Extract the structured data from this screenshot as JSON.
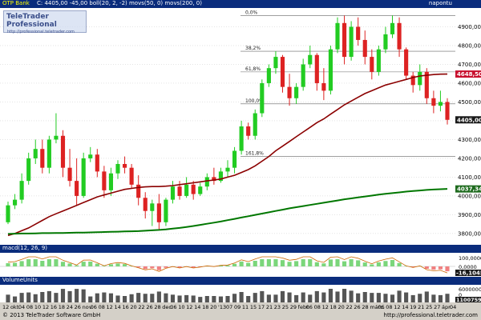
{
  "header": {
    "symbol": "OTP Bank",
    "indicators": "C: 4405,00 -45,00 boll(20, 2, -2) movs(50, 0) movs(200, 0)",
    "period_label": "napontu"
  },
  "watermark": {
    "brand": "TeleTrader Professional",
    "url": "http://professional.teletrader.com"
  },
  "macd": {
    "label": "macd(12, 26, 9)",
    "ticks": [
      "100,0000",
      "0,0000"
    ],
    "current": "-16,1045"
  },
  "volume": {
    "label": "VolumeUnits",
    "ticks": [
      "6000000",
      "0"
    ],
    "current": "1100759"
  },
  "footer": {
    "copyright": "© 2013 TeleTrader Software GmbH",
    "url": "http://professional.teletrader.com"
  },
  "colors": {
    "bull": "#22cc22",
    "bear": "#dd2222",
    "ma50": "#8b0000",
    "ma200": "#007700",
    "strip": "#0a2c7c"
  },
  "chart_data": {
    "type": "candlestick",
    "title": "OTP Bank",
    "ylim": [
      3740,
      5000
    ],
    "y_ticks": [
      3800,
      3900,
      4000,
      4100,
      4200,
      4300,
      4400,
      4500,
      4600,
      4700,
      4800,
      4900
    ],
    "y_tick_labels": [
      "3800,00",
      "3900,00",
      "4000,00",
      "4100,00",
      "4200,00",
      "4300,00",
      "4400,00",
      "4500,00",
      "4600,00",
      "4700,00",
      "4800,00",
      "4900,00"
    ],
    "x_labels": [
      "12",
      "okt.",
      "04",
      "08",
      "10",
      "12",
      "16",
      "18",
      "24",
      "26",
      "nov.",
      "06",
      "08",
      "12",
      "14",
      "16",
      "20",
      "22",
      "26",
      "28",
      "dec.",
      "06",
      "10",
      "12",
      "14",
      "18",
      "20",
      "'13",
      "07",
      "09",
      "11",
      "15",
      "17",
      "21",
      "23",
      "25",
      "29",
      "febr.",
      "06",
      "08",
      "12",
      "18",
      "20",
      "22",
      "26",
      "28",
      "márc.",
      "06",
      "08",
      "12",
      "14",
      "19",
      "21",
      "25",
      "27",
      "ápr.",
      "04"
    ],
    "price_tags": [
      {
        "label": "4648,50",
        "value": 4648.5,
        "color": "#c8102e"
      },
      {
        "label": "4405,00",
        "value": 4405,
        "color": "#1a1a1a"
      },
      {
        "label": "4037,34",
        "value": 4037.34,
        "color": "#1e6b1e"
      }
    ],
    "fib_levels": [
      {
        "label": "0,0%",
        "value": 4960
      },
      {
        "label": "38,2%",
        "value": 4770
      },
      {
        "label": "61,8%",
        "value": 4660
      },
      {
        "label": "100,0%",
        "value": 4490
      },
      {
        "label": "161,8%",
        "value": 4210
      }
    ],
    "series": [
      {
        "name": "ohlc",
        "values": [
          [
            3860,
            3970,
            3850,
            3950
          ],
          [
            3950,
            4010,
            3930,
            3980
          ],
          [
            3980,
            4120,
            3960,
            4080
          ],
          [
            4080,
            4230,
            4060,
            4200
          ],
          [
            4200,
            4300,
            4170,
            4250
          ],
          [
            4250,
            4300,
            4120,
            4150
          ],
          [
            4150,
            4320,
            4120,
            4300
          ],
          [
            4300,
            4440,
            4280,
            4320
          ],
          [
            4320,
            4350,
            4100,
            4150
          ],
          [
            4150,
            4250,
            4050,
            4080
          ],
          [
            4080,
            4200,
            3950,
            4000
          ],
          [
            4000,
            4230,
            3990,
            4200
          ],
          [
            4200,
            4260,
            4180,
            4220
          ],
          [
            4220,
            4250,
            4100,
            4130
          ],
          [
            4130,
            4160,
            3990,
            4030
          ],
          [
            4030,
            4150,
            4000,
            4120
          ],
          [
            4120,
            4190,
            4090,
            4170
          ],
          [
            4170,
            4210,
            4120,
            4150
          ],
          [
            4150,
            4170,
            4040,
            4060
          ],
          [
            4060,
            4110,
            3950,
            3990
          ],
          [
            3990,
            4020,
            3880,
            3920
          ],
          [
            3920,
            3980,
            3840,
            3960
          ],
          [
            3960,
            4010,
            3820,
            3860
          ],
          [
            3860,
            3990,
            3840,
            3980
          ],
          [
            3980,
            4080,
            3960,
            4050
          ],
          [
            4050,
            4080,
            3980,
            4000
          ],
          [
            4000,
            4100,
            3990,
            4060
          ],
          [
            4060,
            4080,
            3980,
            4010
          ],
          [
            4010,
            4070,
            4000,
            4050
          ],
          [
            4050,
            4120,
            4030,
            4100
          ],
          [
            4100,
            4150,
            4060,
            4080
          ],
          [
            4080,
            4150,
            4070,
            4130
          ],
          [
            4130,
            4190,
            4100,
            4150
          ],
          [
            4150,
            4260,
            4120,
            4240
          ],
          [
            4240,
            4400,
            4220,
            4370
          ],
          [
            4370,
            4390,
            4300,
            4320
          ],
          [
            4320,
            4460,
            4300,
            4440
          ],
          [
            4440,
            4620,
            4420,
            4600
          ],
          [
            4600,
            4700,
            4580,
            4680
          ],
          [
            4680,
            4770,
            4650,
            4740
          ],
          [
            4740,
            4750,
            4550,
            4580
          ],
          [
            4580,
            4650,
            4480,
            4520
          ],
          [
            4520,
            4600,
            4490,
            4580
          ],
          [
            4580,
            4730,
            4560,
            4700
          ],
          [
            4700,
            4800,
            4680,
            4750
          ],
          [
            4750,
            4760,
            4560,
            4600
          ],
          [
            4600,
            4680,
            4510,
            4560
          ],
          [
            4560,
            4800,
            4540,
            4780
          ],
          [
            4780,
            4950,
            4760,
            4920
          ],
          [
            4920,
            4960,
            4700,
            4740
          ],
          [
            4740,
            4930,
            4720,
            4900
          ],
          [
            4900,
            4950,
            4800,
            4830
          ],
          [
            4830,
            4880,
            4700,
            4740
          ],
          [
            4740,
            4780,
            4620,
            4660
          ],
          [
            4660,
            4800,
            4640,
            4780
          ],
          [
            4780,
            4900,
            4760,
            4860
          ],
          [
            4860,
            4960,
            4840,
            4920
          ],
          [
            4920,
            4950,
            4740,
            4780
          ],
          [
            4780,
            4790,
            4620,
            4640
          ],
          [
            4640,
            4660,
            4550,
            4590
          ],
          [
            4590,
            4700,
            4560,
            4660
          ],
          [
            4660,
            4680,
            4490,
            4520
          ],
          [
            4520,
            4560,
            4440,
            4480
          ],
          [
            4480,
            4560,
            4450,
            4500
          ],
          [
            4500,
            4520,
            4380,
            4405
          ]
        ]
      },
      {
        "name": "movs(50, 0)",
        "values": [
          3790,
          3800,
          3815,
          3830,
          3850,
          3870,
          3890,
          3905,
          3920,
          3935,
          3950,
          3965,
          3980,
          3995,
          4005,
          4015,
          4025,
          4035,
          4040,
          4045,
          4048,
          4050,
          4050,
          4052,
          4055,
          4060,
          4065,
          4070,
          4075,
          4080,
          4085,
          4090,
          4100,
          4110,
          4125,
          4140,
          4160,
          4185,
          4210,
          4240,
          4265,
          4290,
          4315,
          4340,
          4365,
          4390,
          4410,
          4435,
          4460,
          4485,
          4505,
          4525,
          4545,
          4560,
          4575,
          4590,
          4600,
          4610,
          4620,
          4630,
          4638,
          4642,
          4646,
          4648,
          4648.5
        ]
      },
      {
        "name": "movs(200, 0)",
        "values": [
          3798,
          3799,
          3800,
          3800,
          3801,
          3802,
          3802,
          3803,
          3803,
          3804,
          3805,
          3805,
          3806,
          3807,
          3808,
          3809,
          3810,
          3811,
          3812,
          3813,
          3815,
          3817,
          3819,
          3822,
          3826,
          3830,
          3835,
          3840,
          3846,
          3852,
          3858,
          3864,
          3871,
          3878,
          3885,
          3892,
          3899,
          3906,
          3913,
          3920,
          3927,
          3934,
          3940,
          3946,
          3952,
          3958,
          3964,
          3970,
          3976,
          3982,
          3987,
          3992,
          3997,
          4002,
          4007,
          4011,
          4015,
          4019,
          4023,
          4026,
          4029,
          4032,
          4034,
          4036,
          4037.34
        ]
      }
    ]
  }
}
